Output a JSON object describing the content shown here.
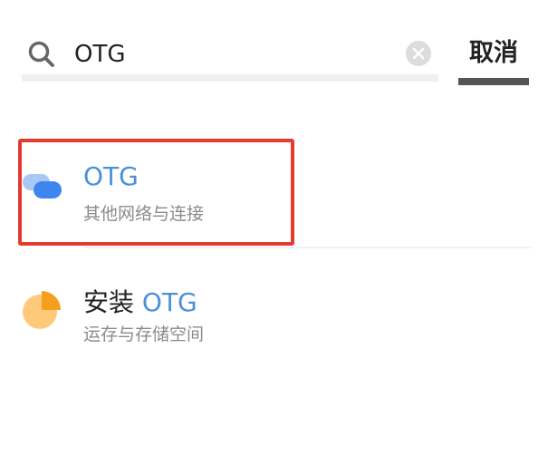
{
  "search": {
    "value": "OTG",
    "cancel_label": "取消"
  },
  "results": [
    {
      "title_prefix": "",
      "title_match": "OTG",
      "subtitle": "其他网络与连接",
      "icon": "connection-icon",
      "highlighted": true
    },
    {
      "title_prefix": "安装 ",
      "title_match": "OTG",
      "subtitle": "运存与存储空间",
      "icon": "storage-pie-icon",
      "highlighted": false
    }
  ],
  "colors": {
    "match_highlight": "#4a90d9",
    "selection_box": "#e53a30",
    "connection_icon_front": "#3d86f0",
    "connection_icon_back": "#a9c8f5",
    "storage_icon_main": "#ffc97a",
    "storage_icon_slice": "#f5a01c"
  }
}
